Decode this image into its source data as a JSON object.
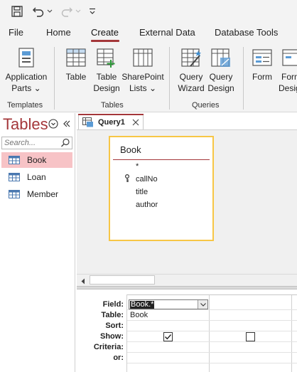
{
  "quick_access": {
    "icons": [
      "save-icon",
      "undo-icon",
      "redo-icon",
      "customize-icon"
    ]
  },
  "ribbon": {
    "tabs": [
      {
        "label": "File"
      },
      {
        "label": "Home"
      },
      {
        "label": "Create",
        "active": true
      },
      {
        "label": "External Data"
      },
      {
        "label": "Database Tools"
      }
    ],
    "buttons": {
      "application_parts": {
        "line1": "Application",
        "line2": "Parts",
        "dropdown": "⌄"
      },
      "table": {
        "line1": "Table"
      },
      "table_design": {
        "line1": "Table",
        "line2": "Design"
      },
      "sharepoint_lists": {
        "line1": "SharePoint",
        "line2": "Lists",
        "dropdown": "⌄"
      },
      "query_wizard": {
        "line1": "Query",
        "line2": "Wizard"
      },
      "query_design": {
        "line1": "Query",
        "line2": "Design"
      },
      "form": {
        "line1": "Form"
      },
      "form_design": {
        "line1": "Form",
        "line2": "Desig"
      }
    },
    "groups": {
      "templates": "Templates",
      "tables": "Tables",
      "queries": "Queries"
    }
  },
  "nav_pane": {
    "title": "Tables",
    "search_placeholder": "Search...",
    "items": [
      {
        "label": "Book",
        "selected": true
      },
      {
        "label": "Loan"
      },
      {
        "label": "Member"
      }
    ]
  },
  "document": {
    "tab_label": "Query1",
    "table_box": {
      "title": "Book",
      "fields": [
        "*",
        "callNo",
        "title",
        "author"
      ],
      "key_field": "callNo"
    },
    "grid": {
      "row_labels": [
        "Field:",
        "Table:",
        "Sort:",
        "Show:",
        "Criteria:",
        "or:"
      ],
      "col1": {
        "field": "Book.*",
        "table": "Book",
        "show": true
      },
      "col2": {
        "field": "",
        "table": "",
        "show": false
      }
    }
  },
  "colors": {
    "accent": "#a4373a",
    "selection": "#f7c3c6",
    "table_border": "#f7c646"
  }
}
